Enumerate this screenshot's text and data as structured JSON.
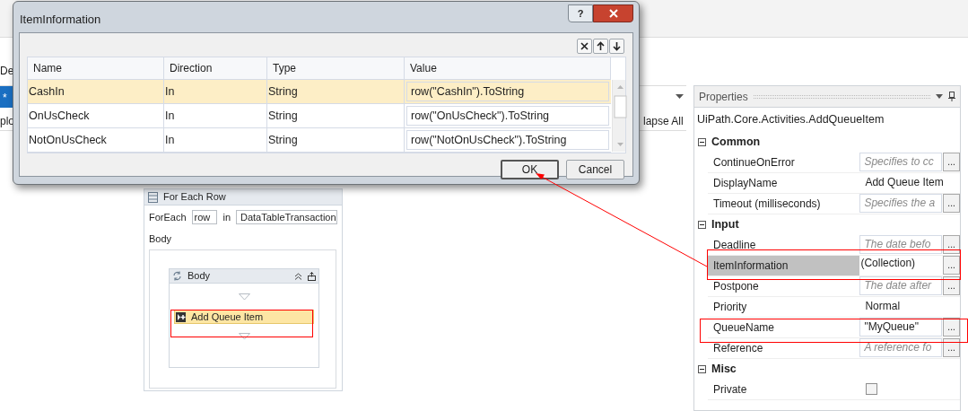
{
  "background": {
    "left_texts": [
      "De",
      "*",
      "plo"
    ],
    "collapse_label": "lapse All"
  },
  "dialog": {
    "title": "ItemInformation",
    "help": "?",
    "columns": [
      "Name",
      "Direction",
      "Type",
      "Value"
    ],
    "rows": [
      {
        "name": "CashIn",
        "direction": "In",
        "type": "String",
        "value": "row(\"CashIn\").ToString",
        "selected": true
      },
      {
        "name": "OnUsCheck",
        "direction": "In",
        "type": "String",
        "value": "row(\"OnUsCheck\").ToString",
        "selected": false
      },
      {
        "name": "NotOnUsCheck",
        "direction": "In",
        "type": "String",
        "value": "row(\"NotOnUsCheck\").ToString",
        "selected": false
      }
    ],
    "buttons": [
      {
        "label": "OK",
        "default": true
      },
      {
        "label": "Cancel",
        "default": false
      }
    ]
  },
  "designer": {
    "title": "For Each Row",
    "foreach_label": "ForEach",
    "item_var": "row",
    "in_label": "in",
    "collection": "DataTableTransaction",
    "body_label": "Body",
    "sequence_title": "Body",
    "activity": {
      "label": "Add Queue Item",
      "selected": true
    }
  },
  "properties": {
    "title": "Properties",
    "class_name": "UiPath.Core.Activities.AddQueueItem",
    "categories": [
      {
        "name": "Common",
        "expanded": true,
        "props": [
          {
            "name": "ContinueOnError",
            "kind": "placeholder",
            "placeholder": "Specifies to cc",
            "button": "...",
            "selected": false
          },
          {
            "name": "DisplayName",
            "kind": "text",
            "value": "Add Queue Item",
            "selected": false
          },
          {
            "name": "Timeout (milliseconds)",
            "kind": "placeholder",
            "placeholder": "Specifies the a",
            "button": "...",
            "selected": false
          }
        ]
      },
      {
        "name": "Input",
        "expanded": true,
        "props": [
          {
            "name": "Deadline",
            "kind": "placeholder",
            "placeholder": "The date befo",
            "button": "...",
            "selected": false
          },
          {
            "name": "ItemInformation",
            "kind": "collection",
            "value": "(Collection)",
            "button": "...",
            "selected": true
          },
          {
            "name": "Postpone",
            "kind": "placeholder",
            "placeholder": "The date after",
            "button": "...",
            "selected": false
          },
          {
            "name": "Priority",
            "kind": "text",
            "value": "Normal",
            "selected": false
          },
          {
            "name": "QueueName",
            "kind": "expression",
            "value": "\"MyQueue\"",
            "button": "...",
            "selected": false
          },
          {
            "name": "Reference",
            "kind": "placeholder",
            "placeholder": "A reference fo",
            "button": "...",
            "selected": false
          }
        ]
      },
      {
        "name": "Misc",
        "expanded": true,
        "props": [
          {
            "name": "Private",
            "kind": "checkbox",
            "checked": false,
            "selected": false
          }
        ]
      }
    ]
  }
}
